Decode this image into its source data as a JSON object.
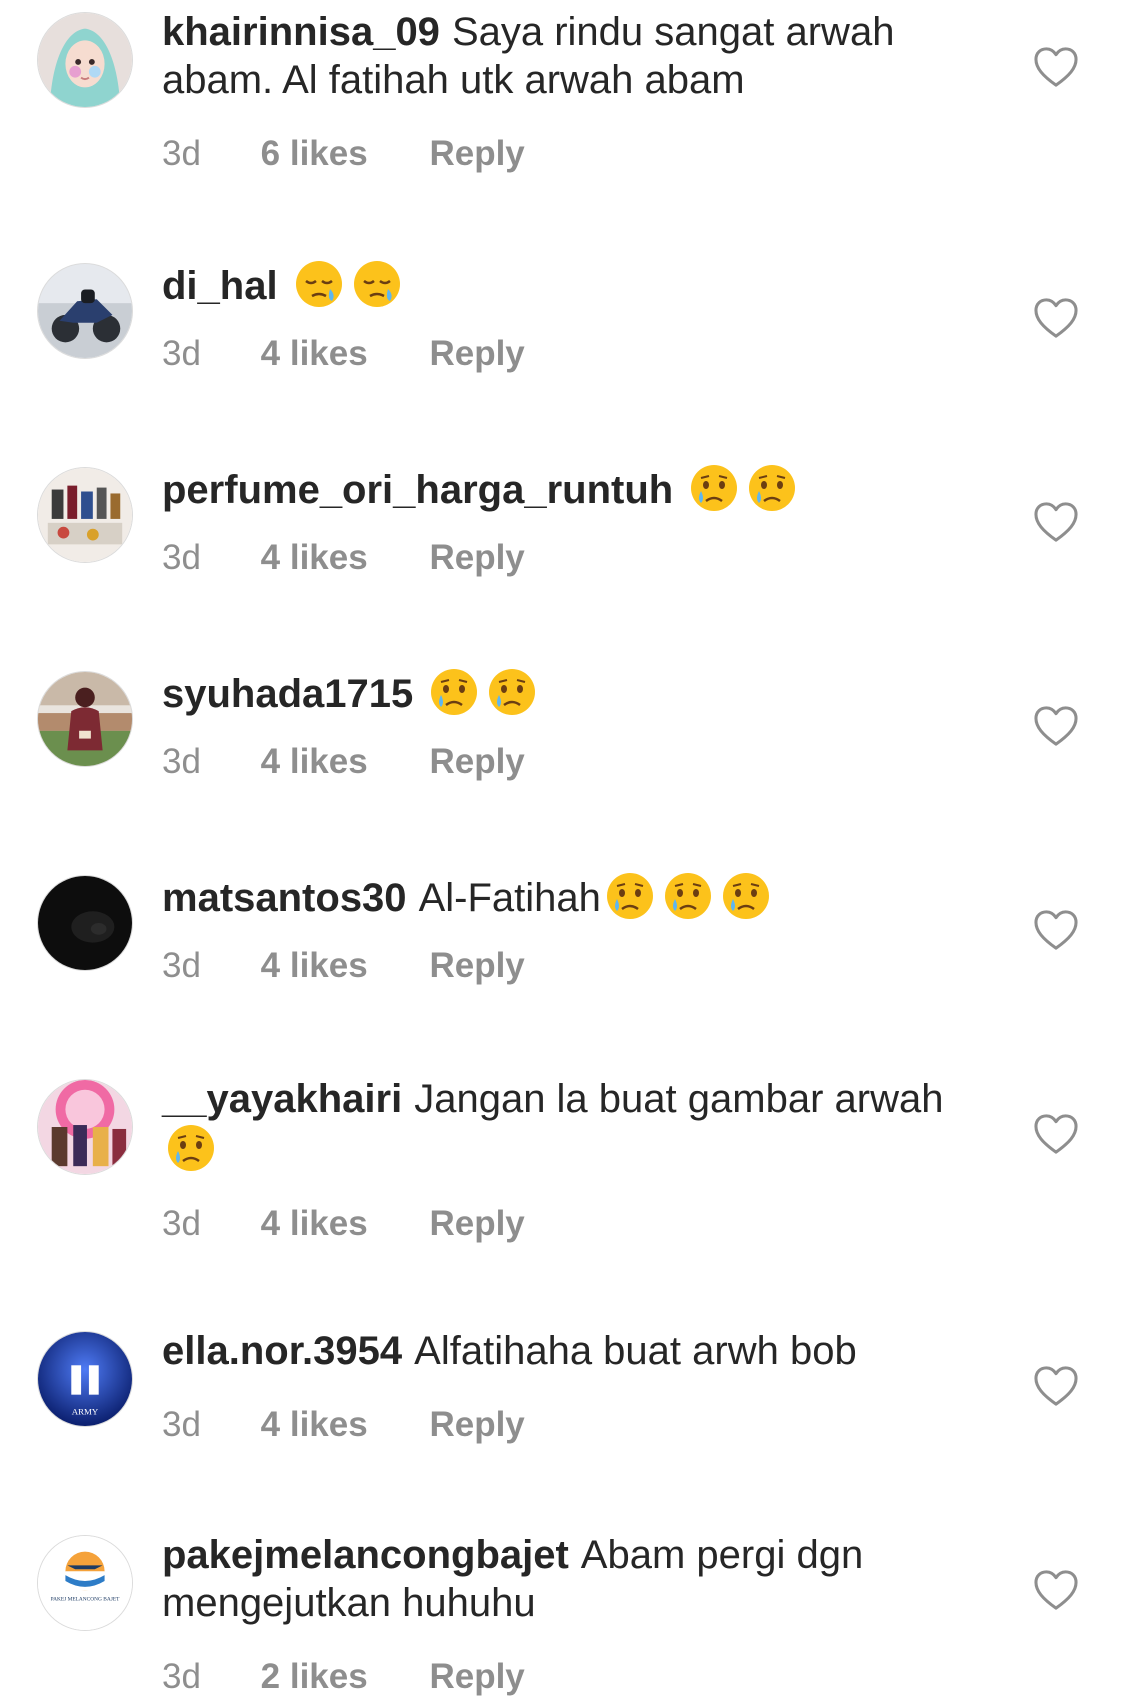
{
  "comments": [
    {
      "username": "khairinnisa_09",
      "text": "Saya rindu sangat arwah abam. Al fatihah utk arwah abam",
      "emojis": [],
      "time": "3d",
      "likes": "6 likes",
      "reply": "Reply",
      "avatar": "girl-hijab-avatar"
    },
    {
      "username": "di_hal",
      "text": "",
      "emojis": [
        "sleepy-face",
        "sleepy-face"
      ],
      "time": "3d",
      "likes": "4 likes",
      "reply": "Reply",
      "avatar": "motorcycle-avatar"
    },
    {
      "username": "perfume_ori_harga_runtuh",
      "text": "",
      "emojis": [
        "crying-face",
        "crying-face"
      ],
      "time": "3d",
      "likes": "4 likes",
      "reply": "Reply",
      "avatar": "perfume-bottles-avatar"
    },
    {
      "username": "syuhada1715",
      "text": "",
      "emojis": [
        "crying-face",
        "crying-face"
      ],
      "time": "3d",
      "likes": "4 likes",
      "reply": "Reply",
      "avatar": "person-outdoor-avatar"
    },
    {
      "username": "matsantos30",
      "text": "Al-Fatihah",
      "emojis": [
        "crying-face",
        "crying-face",
        "crying-face"
      ],
      "time": "3d",
      "likes": "4 likes",
      "reply": "Reply",
      "avatar": "dark-photo-avatar"
    },
    {
      "username": "__yayakhairi",
      "text": "Jangan la buat gambar arwah",
      "emojis": [
        "crying-face"
      ],
      "time": "3d",
      "likes": "4 likes",
      "reply": "Reply",
      "avatar": "colorful-group-avatar"
    },
    {
      "username": "ella.nor.3954",
      "text": "Alfatihaha buat arwh bob",
      "emojis": [],
      "time": "3d",
      "likes": "4 likes",
      "reply": "Reply",
      "avatar": "army-logo-avatar",
      "avatar_caption": "ARMY"
    },
    {
      "username": "pakejmelancongbajet",
      "text": "Abam pergi dgn mengejutkan huhuhu",
      "emojis": [],
      "time": "3d",
      "likes": "2 likes",
      "reply": "Reply",
      "avatar": "travel-logo-avatar",
      "avatar_caption": "PAKEJ MELANCONG BAJET"
    }
  ],
  "colors": {
    "text": "#262626",
    "meta": "#8e8e8e",
    "heart_outline": "#8e8e8e",
    "background": "#ffffff"
  }
}
